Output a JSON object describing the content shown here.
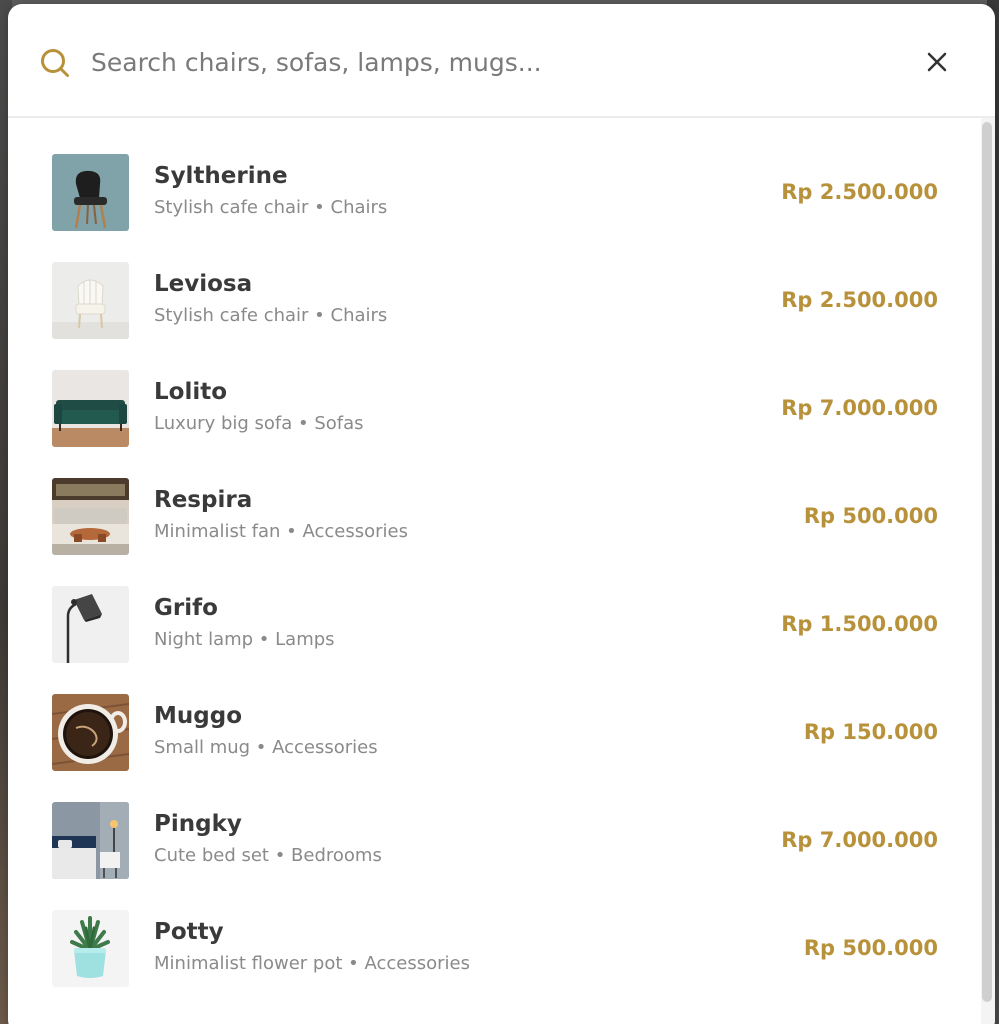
{
  "search": {
    "placeholder": "Search chairs, sofas, lamps, mugs..."
  },
  "results": [
    {
      "name": "Syltherine",
      "description": "Stylish cafe chair",
      "category": "Chairs",
      "meta": "Stylish cafe chair • Chairs",
      "price": "Rp 2.500.000",
      "thumb_icon": "black-chair-image"
    },
    {
      "name": "Leviosa",
      "description": "Stylish cafe chair",
      "category": "Chairs",
      "meta": "Stylish cafe chair • Chairs",
      "price": "Rp 2.500.000",
      "thumb_icon": "white-chair-image"
    },
    {
      "name": "Lolito",
      "description": "Luxury big sofa",
      "category": "Sofas",
      "meta": "Luxury big sofa • Sofas",
      "price": "Rp 7.000.000",
      "thumb_icon": "green-sofa-image"
    },
    {
      "name": "Respira",
      "description": "Minimalist fan",
      "category": "Accessories",
      "meta": "Minimalist fan • Accessories",
      "price": "Rp 500.000",
      "thumb_icon": "living-room-image"
    },
    {
      "name": "Grifo",
      "description": "Night lamp",
      "category": "Lamps",
      "meta": "Night lamp • Lamps",
      "price": "Rp 1.500.000",
      "thumb_icon": "floor-lamp-image"
    },
    {
      "name": "Muggo",
      "description": "Small mug",
      "category": "Accessories",
      "meta": "Small mug • Accessories",
      "price": "Rp 150.000",
      "thumb_icon": "coffee-mug-image"
    },
    {
      "name": "Pingky",
      "description": "Cute bed set",
      "category": "Bedrooms",
      "meta": "Cute bed set • Bedrooms",
      "price": "Rp 7.000.000",
      "thumb_icon": "bedroom-image"
    },
    {
      "name": "Potty",
      "description": "Minimalist flower pot",
      "category": "Accessories",
      "meta": "Minimalist flower pot • Accessories",
      "price": "Rp 500.000",
      "thumb_icon": "flower-pot-image"
    }
  ],
  "colors": {
    "accent": "#b8923a",
    "title_text": "#3a3a3a",
    "meta_text": "#8a8a8a"
  }
}
